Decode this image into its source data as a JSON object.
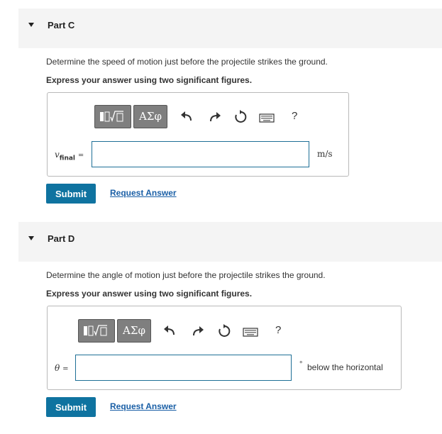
{
  "partC": {
    "title": "Part C",
    "question": "Determine the speed of motion just before the projectile strikes the ground.",
    "instruction": "Express your answer using two significant figures.",
    "toolbar": {
      "greek_label": "ΑΣφ",
      "help_label": "?"
    },
    "variable": {
      "symbol": "v",
      "subscript": "final",
      "equals": "="
    },
    "input_value": "",
    "units": "m/s",
    "submit_label": "Submit",
    "request_label": "Request Answer"
  },
  "partD": {
    "title": "Part D",
    "question": "Determine the angle of motion just before the projectile strikes the ground.",
    "instruction": "Express your answer using two significant figures.",
    "toolbar": {
      "greek_label": "ΑΣφ",
      "help_label": "?"
    },
    "variable": {
      "symbol": "θ",
      "equals": "="
    },
    "input_value": "",
    "units_degree": "°",
    "units": "below the horizontal",
    "submit_label": "Submit",
    "request_label": "Request Answer"
  },
  "icons": [
    "caret-down-icon",
    "template-icon",
    "undo-icon",
    "redo-icon",
    "reset-icon",
    "keyboard-icon",
    "help-icon"
  ],
  "colors": {
    "accent": "#0f73a0",
    "link": "#1a5fa6",
    "input_border": "#1e6f96",
    "toolbar_button": "#7f7f7f",
    "header_bg": "#f4f4f4"
  }
}
